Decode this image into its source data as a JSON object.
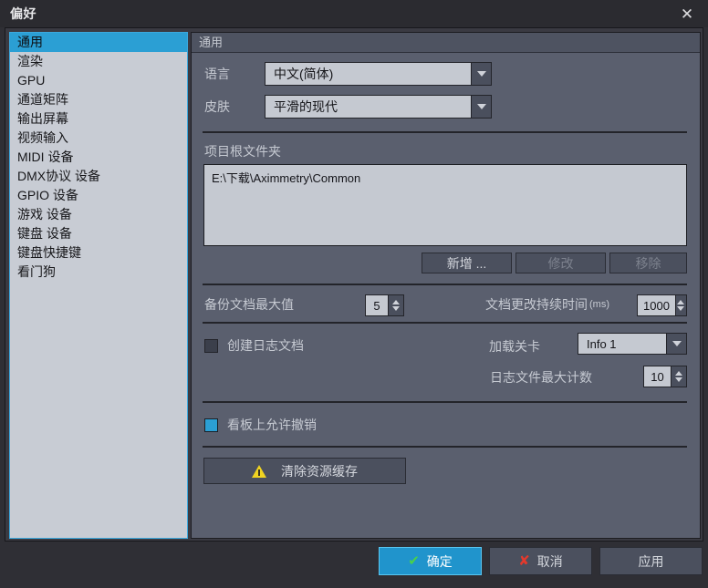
{
  "window": {
    "title": "偏好",
    "close_icon": "close-icon"
  },
  "sidebar": {
    "items": [
      {
        "label": "通用",
        "selected": true
      },
      {
        "label": "渲染",
        "selected": false
      },
      {
        "label": "GPU",
        "selected": false
      },
      {
        "label": "通道矩阵",
        "selected": false
      },
      {
        "label": "输出屏幕",
        "selected": false
      },
      {
        "label": "视频输入",
        "selected": false
      },
      {
        "label": "MIDI 设备",
        "selected": false
      },
      {
        "label": "DMX协议 设备",
        "selected": false
      },
      {
        "label": "GPIO 设备",
        "selected": false
      },
      {
        "label": "游戏 设备",
        "selected": false
      },
      {
        "label": "键盘 设备",
        "selected": false
      },
      {
        "label": "键盘快捷键",
        "selected": false
      },
      {
        "label": "看门狗",
        "selected": false
      }
    ]
  },
  "panel": {
    "header": "通用",
    "language": {
      "label": "语言",
      "value": "中文(简体)"
    },
    "skin": {
      "label": "皮肤",
      "value": "平滑的现代"
    },
    "project_root": {
      "label": "项目根文件夹",
      "paths": [
        "E:\\下载\\Aximmetry\\Common"
      ],
      "buttons": {
        "add": "新增 ...",
        "modify": "修改",
        "remove": "移除"
      }
    },
    "backup": {
      "max_docs_label": "备份文档最大值",
      "max_docs_value": "5",
      "change_duration_label": "文档更改持续时间",
      "change_duration_unit": "(ms)",
      "change_duration_value": "1000"
    },
    "logging": {
      "create_log_label": "创建日志文档",
      "create_log_checked": false,
      "load_level_label": "加载关卡",
      "load_level_value": "Info 1",
      "max_log_files_label": "日志文件最大计数",
      "max_log_files_value": "10"
    },
    "undo": {
      "label": "看板上允许撤销",
      "checked": true
    },
    "clear_cache": {
      "label": "清除资源缓存",
      "icon": "warning-triangle-icon"
    }
  },
  "footer": {
    "ok": "确定",
    "cancel": "取消",
    "apply": "应用",
    "ok_glyph": "✔",
    "cancel_glyph": "✘"
  }
}
